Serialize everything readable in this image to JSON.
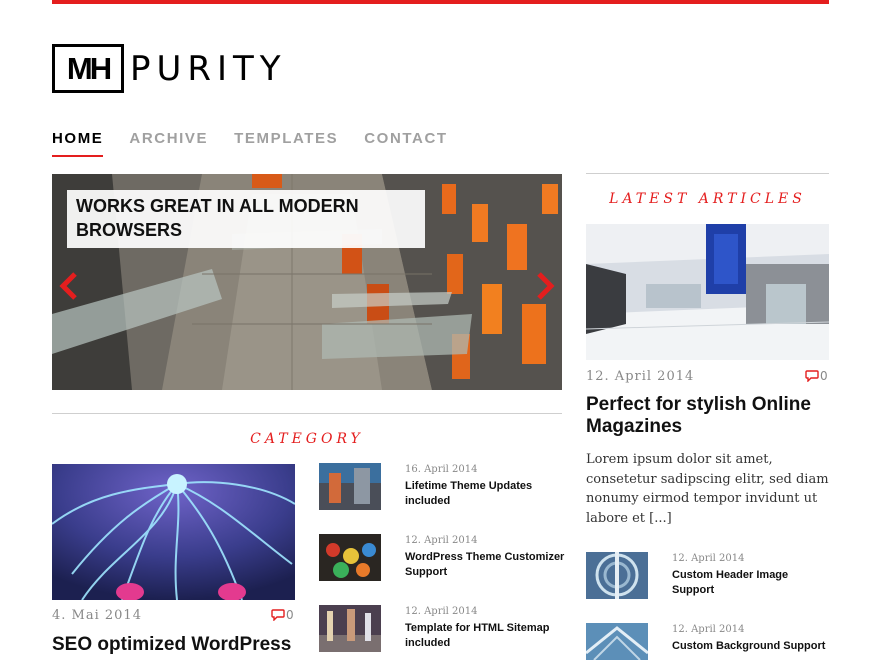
{
  "brand": {
    "logo_mark": "MH",
    "name": "PURITY"
  },
  "nav": {
    "items": [
      {
        "label": "HOME",
        "active": true
      },
      {
        "label": "ARCHIVE",
        "active": false
      },
      {
        "label": "TEMPLATES",
        "active": false
      },
      {
        "label": "CONTACT",
        "active": false
      }
    ]
  },
  "slider": {
    "caption": "WORKS GREAT IN ALL MODERN BROWSERS",
    "prev_icon": "chevron-left-icon",
    "next_icon": "chevron-right-icon"
  },
  "category_section": {
    "title": "CATEGORY",
    "featured": {
      "date": "4. Mai 2014",
      "comments": "0",
      "title": "SEO optimized WordPress"
    },
    "list": [
      {
        "date": "16. April 2014",
        "title": "Lifetime Theme Updates included"
      },
      {
        "date": "12. April 2014",
        "title": "WordPress Theme Customizer Support"
      },
      {
        "date": "12. April 2014",
        "title": "Template for HTML Sitemap included"
      }
    ]
  },
  "sidebar": {
    "title": "LATEST ARTICLES",
    "featured": {
      "date": "12. April 2014",
      "comments": "0",
      "title": "Perfect for stylish Online Magazines",
      "excerpt": "Lorem ipsum dolor sit amet, consetetur sadipscing elitr, sed diam nonumy eirmod tempor invidunt ut labore et",
      "more": "[...]"
    },
    "list": [
      {
        "date": "12. April 2014",
        "title": "Custom Header Image Support"
      },
      {
        "date": "12. April 2014",
        "title": "Custom Background Support"
      }
    ]
  },
  "colors": {
    "accent": "#e41e1e",
    "muted": "#a0a0a0",
    "rule": "#cfcfcf"
  }
}
